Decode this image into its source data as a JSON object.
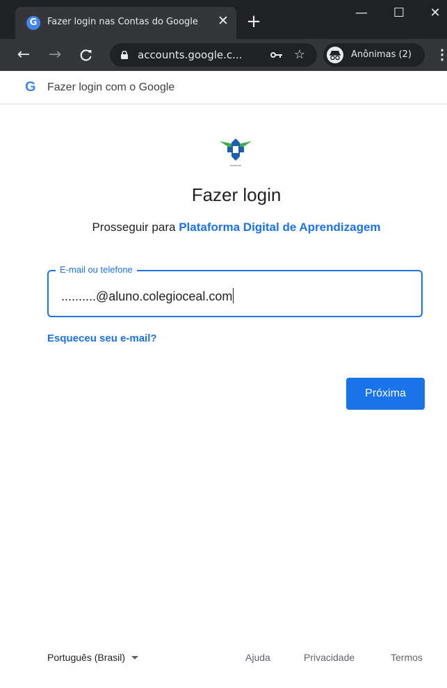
{
  "browser": {
    "tab": {
      "title": "Fazer login nas Contas do Google",
      "favicon": "G",
      "close_glyph": "✕"
    },
    "new_tab_glyph": "+",
    "window_controls": {
      "minimize": "—",
      "maximize": "☐",
      "close": "✕"
    },
    "toolbar": {
      "back": "←",
      "forward": "→",
      "reload": "C",
      "url": "accounts.google.c...",
      "key_glyph": "⚷",
      "star_glyph": "☆",
      "incognito_label": "Anônimas (2)",
      "menu_glyph": "⋮"
    },
    "infobar": {
      "icon": "G",
      "text": "Fazer login com o Google"
    }
  },
  "login": {
    "title": "Fazer login",
    "subtitle_prefix": "Prosseguir para",
    "subtitle_link": "Plataforma Digital de Aprendizagem",
    "email_field": {
      "label": "E-mail ou telefone",
      "value": "..........@aluno.colegioceal.com"
    },
    "forgot_email": "Esqueceu seu e-mail?",
    "next_button": "Próxima"
  },
  "footer": {
    "language": "Português (Brasil)",
    "links": {
      "help": "Ajuda",
      "privacy": "Privacidade",
      "terms": "Termos"
    }
  },
  "colors": {
    "accent": "#1a73e8",
    "chrome_dark": "#202124",
    "chrome_toolbar": "#35363a",
    "logo_green": "#3fae49",
    "logo_blue": "#1a5fb4"
  },
  "icons": {
    "logo": "ceal-school-logo",
    "lock": "lock-icon",
    "key": "key-icon",
    "star": "bookmark-star-icon",
    "incognito": "incognito-icon"
  }
}
